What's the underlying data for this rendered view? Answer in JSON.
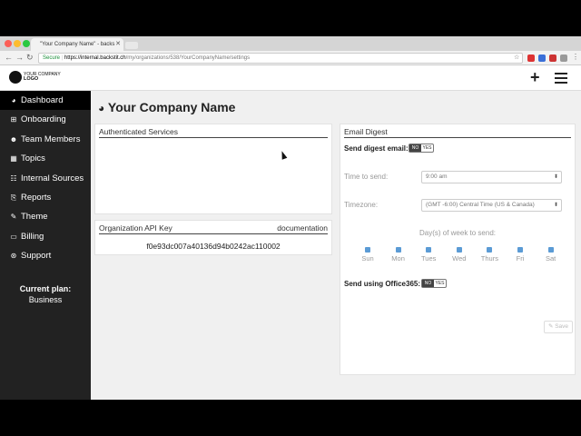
{
  "browser": {
    "tab_title": "\"Your Company Name\" - backs",
    "url_secure": "Secure",
    "url_host": "https://internal.backstit.ch",
    "url_path": "/my/organizations/538/YourCompanyName/settings"
  },
  "header": {
    "logo_line1": "YOUR COMPANY",
    "logo_line2": "LOGO"
  },
  "sidebar": {
    "items": [
      {
        "label": "Dashboard",
        "icon": "dashboard-icon",
        "glyph": "◕"
      },
      {
        "label": "Onboarding",
        "icon": "onboarding-icon",
        "glyph": "⊞"
      },
      {
        "label": "Team Members",
        "icon": "team-icon",
        "glyph": "☻"
      },
      {
        "label": "Topics",
        "icon": "topics-icon",
        "glyph": "▦"
      },
      {
        "label": "Internal Sources",
        "icon": "sources-icon",
        "glyph": "☷"
      },
      {
        "label": "Reports",
        "icon": "reports-icon",
        "glyph": "⎘"
      },
      {
        "label": "Theme",
        "icon": "theme-icon",
        "glyph": "✎"
      },
      {
        "label": "Billing",
        "icon": "billing-icon",
        "glyph": "▭"
      },
      {
        "label": "Support",
        "icon": "support-icon",
        "glyph": "⊛"
      }
    ],
    "plan_label": "Current plan:",
    "plan_value": "Business"
  },
  "main": {
    "title": "Your Company Name",
    "auth_services_title": "Authenticated Services",
    "api_key_title": "Organization API Key",
    "api_key_link": "documentation",
    "api_key_value": "f0e93dc007a40136d94b0242ac110002"
  },
  "email_digest": {
    "title": "Email Digest",
    "send_label": "Send digest email:",
    "toggle_no": "NO",
    "toggle_yes": "YES",
    "time_label": "Time to send:",
    "time_value": "9:00 am",
    "timezone_label": "Timezone:",
    "timezone_value": "(GMT -6:00) Central Time (US & Canada)",
    "days_label": "Day(s) of week to send:",
    "days": [
      "Sun",
      "Mon",
      "Tues",
      "Wed",
      "Thurs",
      "Fri",
      "Sat"
    ],
    "office365_label": "Send using Office365:",
    "save_label": "Save"
  }
}
